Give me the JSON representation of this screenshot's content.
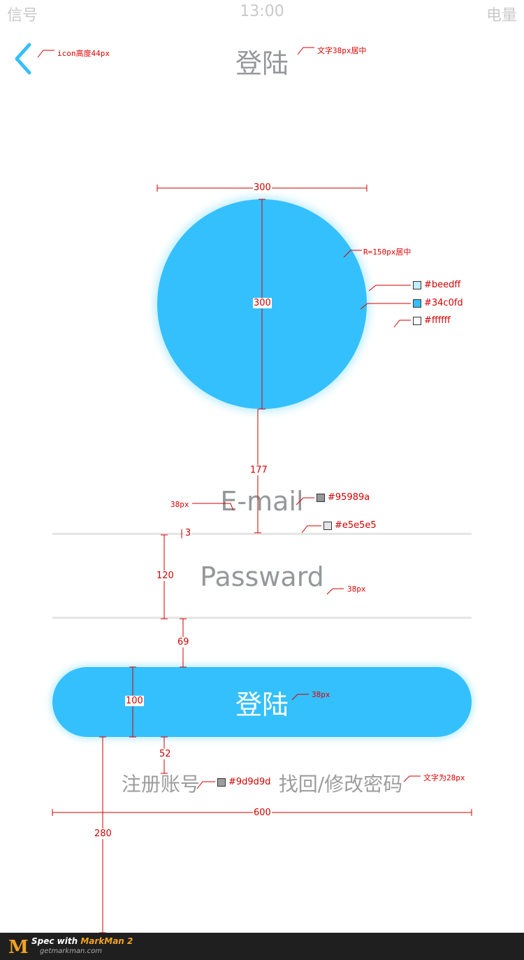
{
  "status_bar": {
    "signal": "信号",
    "time": "13:00",
    "battery": "电量"
  },
  "header": {
    "title": "登陆"
  },
  "form": {
    "email_placeholder": "E-mail",
    "password_placeholder": "Passward",
    "login_label": "登陆"
  },
  "links": {
    "register": "注册账号",
    "recover": "找回/修改密码"
  },
  "colors": {
    "accent": "#34c0fd",
    "glow": "#beedff",
    "text_gray": "#95989a",
    "divider": "#e5e5e5",
    "link_gray": "#9d9d9d",
    "white": "#ffffff"
  },
  "annotations": {
    "icon_height": "icon高度44px",
    "title_text": "文字38px居中",
    "radius": "R=150px居中",
    "color_beedff": "#beedff",
    "color_34c0fd": "#34c0fd",
    "color_ffffff": "#ffffff",
    "dim_300_w": "300",
    "dim_300_h": "300",
    "dim_177": "177",
    "email_size": "38px",
    "color_95989a": "#95989a",
    "color_e5e5e5": "#e5e5e5",
    "dim_3": "3",
    "dim_120": "120",
    "password_size": "38px",
    "dim_69": "69",
    "dim_100": "100",
    "button_text_size": "38px",
    "dim_52": "52",
    "color_9d9d9d": "#9d9d9d",
    "links_text": "文字为28px",
    "dim_600": "600",
    "dim_280": "280"
  },
  "footer": {
    "logo": "M",
    "line1_prefix": "Spec with ",
    "line1_brand": "MarkMan 2",
    "line2": "getmarkman.com"
  },
  "icons": {
    "back": "chevron-left-icon"
  }
}
